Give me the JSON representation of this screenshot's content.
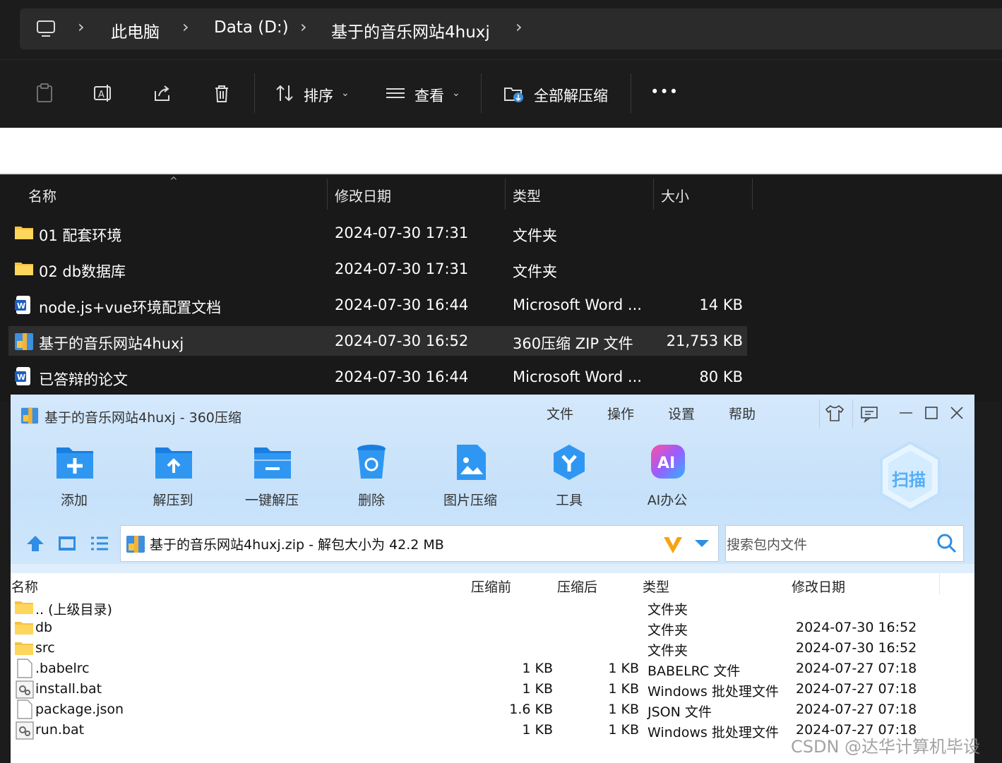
{
  "explorer": {
    "breadcrumb": [
      "此电脑",
      "Data (D:)",
      "基于的音乐网站4huxj"
    ],
    "toolbar": {
      "sort_label": "排序",
      "view_label": "查看",
      "extract_label": "全部解压缩",
      "more_label": "•••"
    },
    "columns": [
      "名称",
      "修改日期",
      "类型",
      "大小"
    ],
    "files": [
      {
        "name": "01 配套环境",
        "date": "2024-07-30 17:31",
        "type": "文件夹",
        "size": "",
        "icon": "folder-icon"
      },
      {
        "name": "02 db数据库",
        "date": "2024-07-30 17:31",
        "type": "文件夹",
        "size": "",
        "icon": "folder-icon"
      },
      {
        "name": "node.js+vue环境配置文档",
        "date": "2024-07-30 16:44",
        "type": "Microsoft Word ...",
        "size": "14 KB",
        "icon": "word-icon"
      },
      {
        "name": "基于的音乐网站4huxj",
        "date": "2024-07-30 16:52",
        "type": "360压缩 ZIP 文件",
        "size": "21,753 KB",
        "icon": "zip-icon"
      },
      {
        "name": "已答辩的论文",
        "date": "2024-07-30 16:44",
        "type": "Microsoft Word ...",
        "size": "80 KB",
        "icon": "word-icon"
      }
    ]
  },
  "zip": {
    "title": "基于的音乐网站4huxj - 360压缩",
    "menu": [
      "文件",
      "操作",
      "设置",
      "帮助"
    ],
    "buttons": [
      "添加",
      "解压到",
      "一键解压",
      "删除",
      "图片压缩",
      "工具",
      "AI办公"
    ],
    "scan_label": "扫描",
    "path_text": "基于的音乐网站4huxj.zip - 解包大小为 42.2 MB",
    "search_placeholder": "搜索包内文件",
    "columns": [
      "名称",
      "压缩前",
      "压缩后",
      "类型",
      "修改日期"
    ],
    "rows": [
      {
        "name": ".. (上级目录)",
        "before": "",
        "after": "",
        "type": "文件夹",
        "date": "",
        "icon": "folder-icon"
      },
      {
        "name": "db",
        "before": "",
        "after": "",
        "type": "文件夹",
        "date": "2024-07-30 16:52",
        "icon": "folder-icon"
      },
      {
        "name": "src",
        "before": "",
        "after": "",
        "type": "文件夹",
        "date": "2024-07-30 16:52",
        "icon": "folder-icon"
      },
      {
        "name": ".babelrc",
        "before": "1 KB",
        "after": "1 KB",
        "type": "BABELRC 文件",
        "date": "2024-07-27 07:18",
        "icon": "file-icon"
      },
      {
        "name": "install.bat",
        "before": "1 KB",
        "after": "1 KB",
        "type": "Windows 批处理文件",
        "date": "2024-07-27 07:18",
        "icon": "bat-icon"
      },
      {
        "name": "package.json",
        "before": "1.6 KB",
        "after": "1 KB",
        "type": "JSON 文件",
        "date": "2024-07-27 07:18",
        "icon": "file-icon"
      },
      {
        "name": "run.bat",
        "before": "1 KB",
        "after": "1 KB",
        "type": "Windows 批处理文件",
        "date": "2024-07-27 07:18",
        "icon": "bat-icon"
      }
    ]
  },
  "watermark": "CSDN @达华计算机毕设"
}
